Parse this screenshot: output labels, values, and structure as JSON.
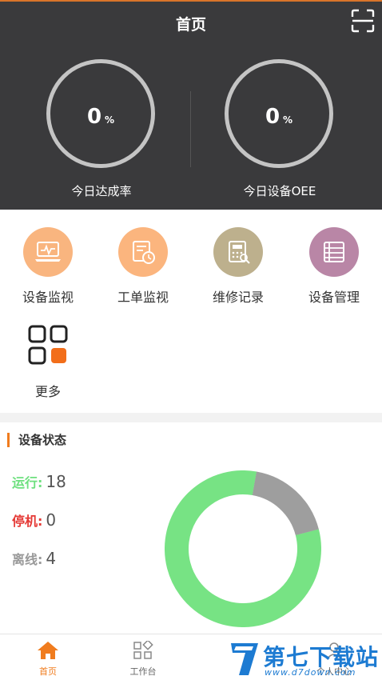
{
  "header": {
    "title": "首页",
    "gauges": [
      {
        "value": "0",
        "unit": "%",
        "label": "今日达成率"
      },
      {
        "value": "0",
        "unit": "%",
        "label": "今日设备OEE"
      }
    ]
  },
  "menu": {
    "items": [
      {
        "label": "设备监视",
        "icon": "laptop-monitor-icon",
        "color": "#f9b57f"
      },
      {
        "label": "工单监视",
        "icon": "work-order-clock-icon",
        "color": "#fbb57e"
      },
      {
        "label": "维修记录",
        "icon": "calculator-record-icon",
        "color": "#bdb08d"
      },
      {
        "label": "设备管理",
        "icon": "list-manage-icon",
        "color": "#b986a6"
      },
      {
        "label": "更多",
        "icon": "grid-more-icon",
        "color": "#f26e1a"
      }
    ]
  },
  "status": {
    "title": "设备状态",
    "rows": [
      {
        "label": "运行:",
        "value": "18",
        "color": "#6ee07f"
      },
      {
        "label": "停机:",
        "value": "0",
        "color": "#e53935"
      },
      {
        "label": "离线:",
        "value": "4",
        "color": "#999999"
      }
    ],
    "donut": {
      "running": 18,
      "stopped": 0,
      "offline": 4,
      "running_color": "#77e384",
      "offline_color": "#9e9e9e"
    }
  },
  "tabbar": {
    "tabs": [
      {
        "label": "首页",
        "icon": "home-icon",
        "active": true
      },
      {
        "label": "工作台",
        "icon": "workbench-icon",
        "active": false
      },
      {
        "label": "个人中心",
        "icon": "user-icon",
        "active": false
      }
    ],
    "active_color": "#f07c1e"
  },
  "watermark": {
    "text": "第七下载站",
    "url": "www.d7down.com"
  }
}
